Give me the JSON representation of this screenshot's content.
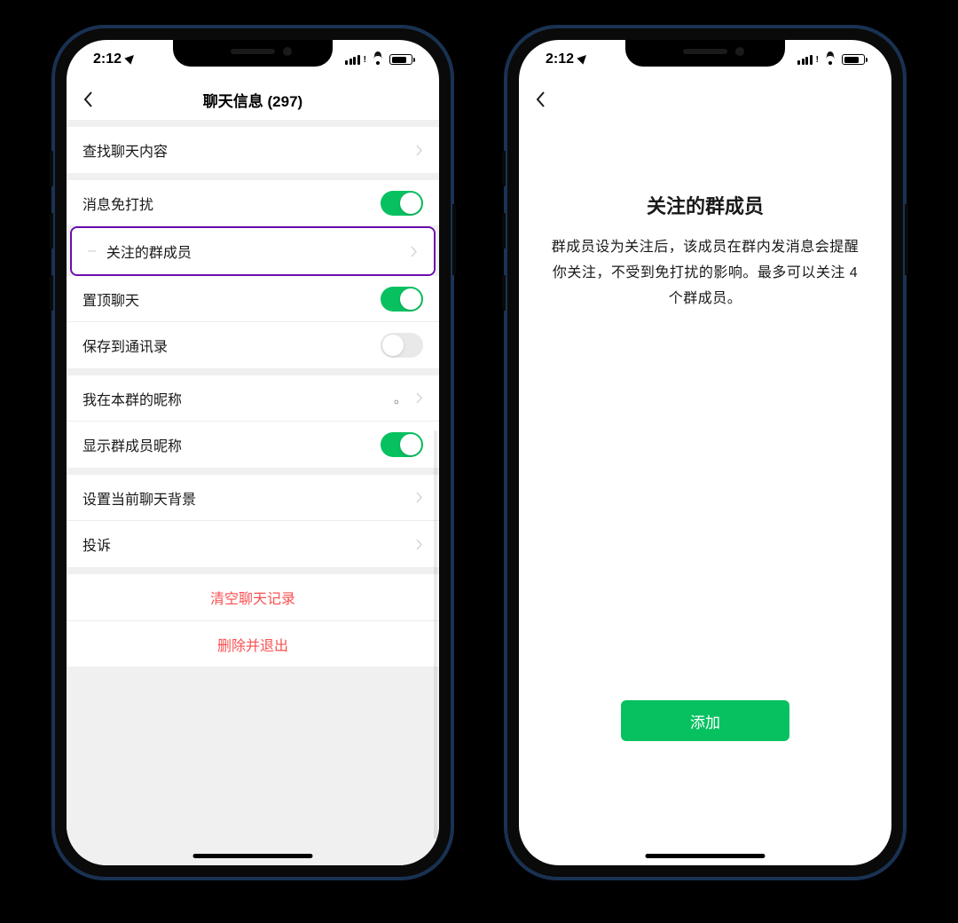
{
  "status": {
    "time": "2:12"
  },
  "screen1": {
    "title": "聊天信息 (297)",
    "rows": {
      "search": "查找聊天内容",
      "mute": "消息免打扰",
      "watched": "关注的群成员",
      "pin": "置顶聊天",
      "save_contacts": "保存到通讯录",
      "my_nick": "我在本群的昵称",
      "my_nick_val": "。",
      "show_nicks": "显示群成员昵称",
      "bg": "设置当前聊天背景",
      "report": "投诉",
      "clear": "清空聊天记录",
      "leave": "删除并退出"
    },
    "toggles": {
      "mute": true,
      "pin": true,
      "save_contacts": false,
      "show_nicks": true
    }
  },
  "screen2": {
    "title": "关注的群成员",
    "desc": "群成员设为关注后，该成员在群内发消息会提醒你关注，不受到免打扰的影响。最多可以关注 4 个群成员。",
    "add": "添加"
  }
}
